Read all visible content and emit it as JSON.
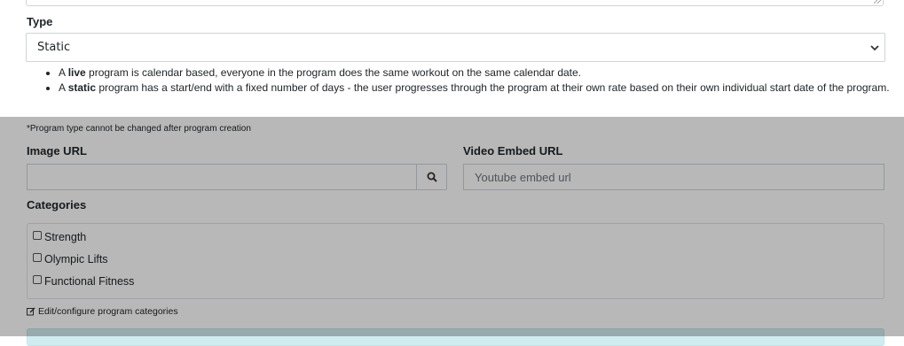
{
  "type_field": {
    "label": "Type",
    "selected_value": "Static",
    "help_items": [
      {
        "before": "A ",
        "bold": "live",
        "after": " program is calendar based, everyone in the program does the same workout on the same calendar date."
      },
      {
        "before": "A ",
        "bold": "static",
        "after": " program has a start/end with a fixed number of days - the user progresses through the program at their own rate based on their own individual start date of the program."
      }
    ],
    "note": "*Program type cannot be changed after program creation"
  },
  "image_url": {
    "label": "Image URL",
    "value": ""
  },
  "video_embed_url": {
    "label": "Video Embed URL",
    "placeholder": "Youtube embed url"
  },
  "categories": {
    "label": "Categories",
    "items": [
      {
        "label": "Strength",
        "checked": false
      },
      {
        "label": "Olympic Lifts",
        "checked": false
      },
      {
        "label": "Functional Fitness",
        "checked": false
      }
    ],
    "edit_link": "Edit/configure program categories"
  },
  "colors": {
    "overlay": "rgba(0,0,0,0.28)",
    "alert_bg": "#d1ecf1"
  }
}
